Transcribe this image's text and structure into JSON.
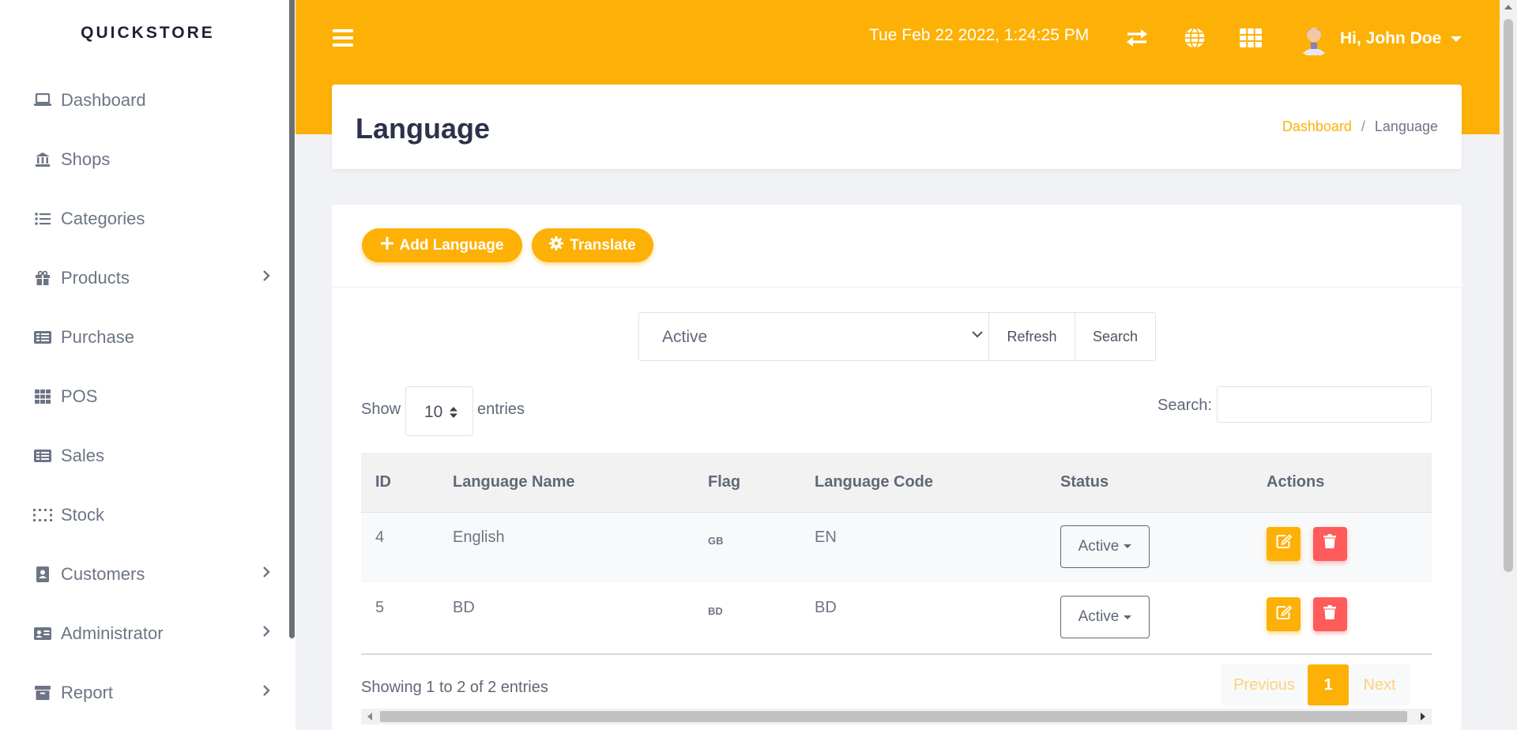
{
  "brand": "QUICKSTORE",
  "sidebar": {
    "items": [
      {
        "label": "Dashboard",
        "icon": "laptop-icon",
        "has_submenu": false
      },
      {
        "label": "Shops",
        "icon": "bank-icon",
        "has_submenu": false
      },
      {
        "label": "Categories",
        "icon": "list-icon",
        "has_submenu": false
      },
      {
        "label": "Products",
        "icon": "gift-icon",
        "has_submenu": true
      },
      {
        "label": "Purchase",
        "icon": "receipt-icon",
        "has_submenu": false
      },
      {
        "label": "POS",
        "icon": "grid-icon",
        "has_submenu": false
      },
      {
        "label": "Sales",
        "icon": "receipt-icon",
        "has_submenu": false
      },
      {
        "label": "Stock",
        "icon": "dots-grid-icon",
        "has_submenu": false
      },
      {
        "label": "Customers",
        "icon": "contact-book-icon",
        "has_submenu": true
      },
      {
        "label": "Administrator",
        "icon": "id-card-icon",
        "has_submenu": true
      },
      {
        "label": "Report",
        "icon": "archive-icon",
        "has_submenu": true
      }
    ]
  },
  "topbar": {
    "datetime": "Tue Feb 22 2022, 1:24:25 PM",
    "icons": [
      "exchange-icon",
      "globe-icon",
      "apps-grid-icon"
    ],
    "user_greeting": "Hi, John Doe"
  },
  "header": {
    "title": "Language",
    "breadcrumb": {
      "link": "Dashboard",
      "separator": "/",
      "current": "Language"
    }
  },
  "actions": {
    "add_label": "Add Language",
    "translate_label": "Translate"
  },
  "filter": {
    "selected": "Active",
    "refresh_label": "Refresh",
    "search_label": "Search"
  },
  "datatable": {
    "show_label": "Show",
    "page_length": "10",
    "entries_label": "entries",
    "search_label": "Search:",
    "columns": [
      "ID",
      "Language Name",
      "Flag",
      "Language Code",
      "Status",
      "Actions"
    ],
    "rows": [
      {
        "id": "4",
        "name": "English",
        "flag": "GB",
        "code": "EN",
        "status": "Active"
      },
      {
        "id": "5",
        "name": "BD",
        "flag": "BD",
        "code": "BD",
        "status": "Active"
      }
    ],
    "info": "Showing 1 to 2 of 2 entries",
    "pagination": {
      "previous": "Previous",
      "current": "1",
      "next": "Next"
    }
  },
  "colors": {
    "accent": "#fdb106",
    "danger": "#ff5b5b",
    "title": "#2b3249"
  }
}
